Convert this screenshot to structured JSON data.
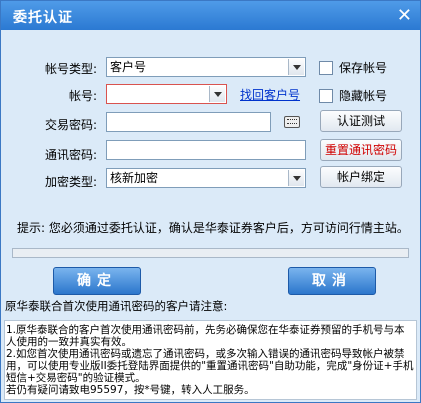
{
  "window": {
    "title": "委托认证",
    "close_glyph": "✕"
  },
  "form": {
    "account_type": {
      "label": "帐号类型:",
      "value": "客户号"
    },
    "account": {
      "label": "帐号:",
      "value": ""
    },
    "find_customer_link": "找回客户号",
    "save_account_label": "保存帐号",
    "hide_account_label": "隐藏帐号",
    "trade_password": {
      "label": "交易密码:",
      "value": ""
    },
    "auth_test_button": "认证测试",
    "comm_password": {
      "label": "通讯密码:",
      "value": ""
    },
    "reset_comm_password_button": "重置通讯密码",
    "encrypt_type": {
      "label": "加密类型:",
      "value": "核新加密"
    },
    "bind_account_button": "帐户绑定"
  },
  "hint": "提示: 您必须通过委托认证，确认是华泰证券客户后，方可访问行情主站。",
  "buttons": {
    "ok": "确定",
    "cancel": "取消"
  },
  "notice": {
    "title": "原华泰联合首次使用通讯密码的客户请注意:",
    "lines": [
      "1.原华泰联合的客户首次使用通讯密码前，先务必确保您在华泰证券预留的手机号与本人使用的一致并真实有效。",
      "2.如您首次使用通讯密码或遗忘了通讯密码，或多次输入错误的通讯密码导致帐户被禁用，可以使用专业版II委托登陆界面提供的\"重置通讯密码\"自助功能，完成\"身份证+手机短信+交易密码\"的验证模式。",
      "若仍有疑问请致电95597，按*号键，转入人工服务。"
    ]
  },
  "colors": {
    "titlebar": "#2b79d2",
    "link": "#0033cc",
    "danger": "#d00000"
  }
}
